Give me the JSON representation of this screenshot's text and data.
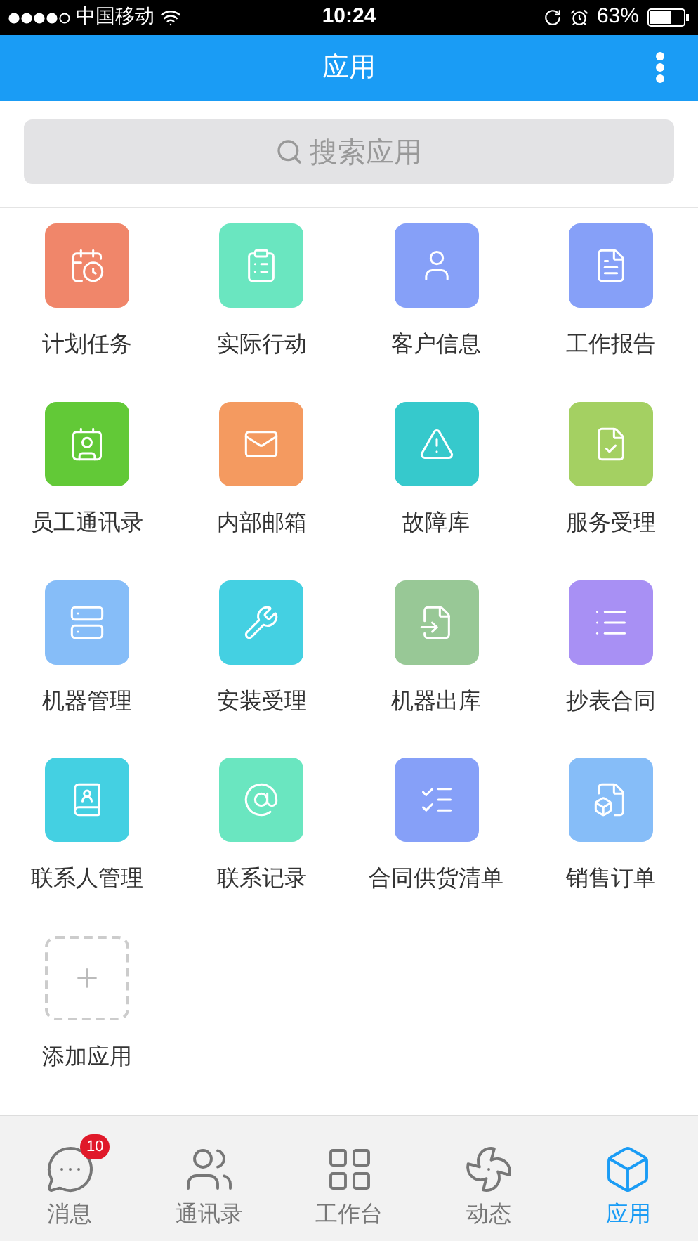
{
  "status_bar": {
    "carrier": "中国移动",
    "time": "10:24",
    "battery": "63%"
  },
  "header": {
    "title": "应用"
  },
  "search": {
    "placeholder": "搜索应用"
  },
  "apps": [
    {
      "kind": "app",
      "label": "计划任务",
      "color": "#f0866a"
    },
    {
      "kind": "app",
      "label": "实际行动",
      "color": "#6ae6c0"
    },
    {
      "kind": "app",
      "label": "客户信息",
      "color": "#86a0f8"
    },
    {
      "kind": "app",
      "label": "工作报告",
      "color": "#86a0f8"
    },
    {
      "kind": "app",
      "label": "员工通讯录",
      "color": "#62c937"
    },
    {
      "kind": "app",
      "label": "内部邮箱",
      "color": "#f49a60"
    },
    {
      "kind": "app",
      "label": "故障库",
      "color": "#36c9cc"
    },
    {
      "kind": "app",
      "label": "服务受理",
      "color": "#a4d062"
    },
    {
      "kind": "app",
      "label": "机器管理",
      "color": "#86bdf8"
    },
    {
      "kind": "app",
      "label": "安装受理",
      "color": "#44d0e2"
    },
    {
      "kind": "app",
      "label": "机器出库",
      "color": "#98c896"
    },
    {
      "kind": "app",
      "label": "抄表合同",
      "color": "#a890f4"
    },
    {
      "kind": "app",
      "label": "联系人管理",
      "color": "#44d0e2"
    },
    {
      "kind": "app",
      "label": "联系记录",
      "color": "#6ae6c0"
    },
    {
      "kind": "app",
      "label": "合同供货清单",
      "color": "#86a0f8"
    },
    {
      "kind": "app",
      "label": "销售订单",
      "color": "#86bdf8"
    },
    {
      "kind": "add",
      "label": "添加应用"
    }
  ],
  "tabs": [
    {
      "label": "消息",
      "badge": "10",
      "selected": false
    },
    {
      "label": "通讯录",
      "selected": false
    },
    {
      "label": "工作台",
      "selected": false
    },
    {
      "label": "动态",
      "selected": false
    },
    {
      "label": "应用",
      "selected": true
    }
  ]
}
